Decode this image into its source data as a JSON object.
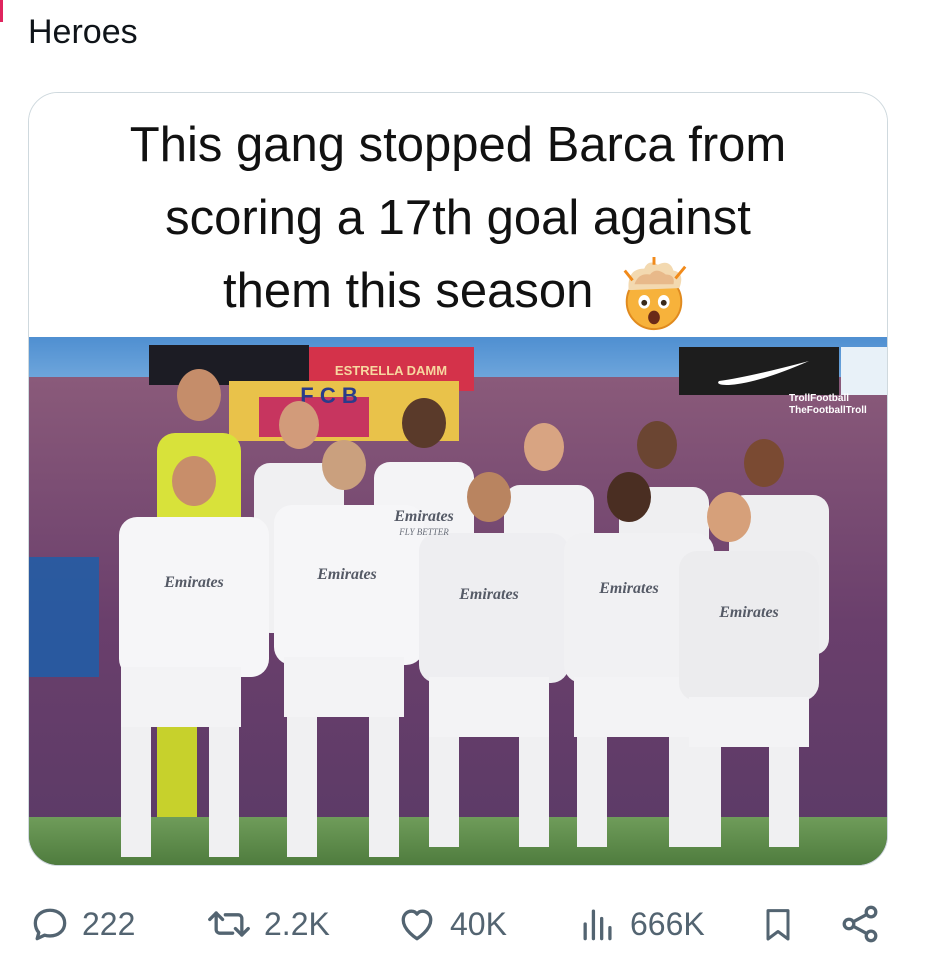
{
  "tweet": {
    "text": "Heroes"
  },
  "media": {
    "caption_line1": "This gang stopped Barca from",
    "caption_line2": "scoring a 17th goal against",
    "caption_line3": "them this season",
    "caption_emoji": "exploding-head-icon",
    "banner_fcb": "F C B",
    "banner_sponsor": "ESTRELLA DAMM",
    "watermark_line1": "TrollFootball",
    "watermark_line2": "TheFootballTroll",
    "shirt_sponsor": "Emirates",
    "shirt_tagline": "FLY BETTER"
  },
  "actions": {
    "replies": "222",
    "reposts": "2.2K",
    "likes": "40K",
    "views": "666K"
  },
  "colors": {
    "action_gray": "#536471",
    "card_border": "#cfd9de",
    "sky_blue": "#5a8fc8"
  }
}
